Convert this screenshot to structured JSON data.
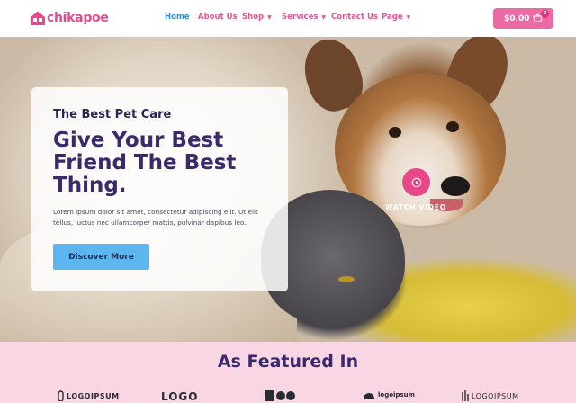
{
  "header": {
    "logo_text": "chikapoe",
    "nav": [
      {
        "label": "Home",
        "active": true,
        "dropdown": false
      },
      {
        "label": "About Us",
        "active": false,
        "dropdown": false
      },
      {
        "label": "Shop",
        "active": false,
        "dropdown": true
      },
      {
        "label": "Services",
        "active": false,
        "dropdown": true
      },
      {
        "label": "Contact Us",
        "active": false,
        "dropdown": false
      },
      {
        "label": "Page",
        "active": false,
        "dropdown": true
      }
    ],
    "cart": {
      "total": "$0.00",
      "count": "0",
      "icon": "shopping-basket-icon"
    }
  },
  "hero": {
    "tagline": "The Best Pet Care",
    "title_lines": [
      "Give Your Best",
      "Friend The Best",
      "Thing."
    ],
    "description": "Lorem ipsum dolor sit amet, consectetur adipiscing elit. Ut elit tellus, luctus nec ullamcorper mattis, pulvinar dapibus leo.",
    "cta_label": "Discover More",
    "video": {
      "label": "WATCH VIDEO",
      "icon": "play-circle-icon"
    }
  },
  "featured": {
    "title": "As Featured In",
    "brands": [
      "LOGOIPSUM",
      "LOGO",
      "",
      "logoipsum",
      "LOGOIPSUM"
    ]
  },
  "colors": {
    "brand_pink": "#ec6aa3",
    "nav_active": "#2f8fcf",
    "heading_purple": "#3a2a6b",
    "cta_blue": "#5eb6f0",
    "featured_bg": "#f9d6e3"
  }
}
